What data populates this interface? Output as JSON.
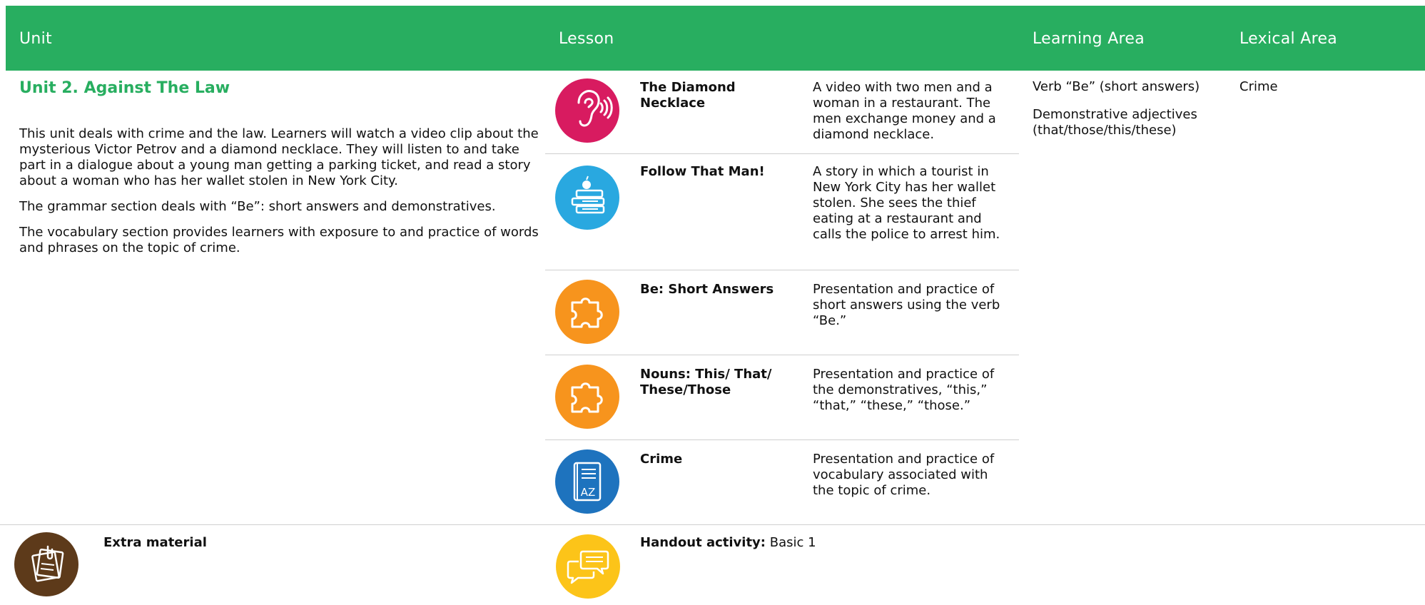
{
  "header": {
    "unit": "Unit",
    "lesson": "Lesson",
    "learning_area": "Learning Area",
    "lexical_area": "Lexical Area"
  },
  "unit": {
    "title": "Unit 2. Against The Law",
    "paragraphs": [
      "This unit deals with crime and the law. Learners will watch a video clip about the mysterious Victor Petrov and a diamond necklace. They will listen to and take part in a dialogue about a young man getting a parking ticket, and read a story about a woman who has her wallet stolen in New York City.",
      "The grammar section deals with “Be”: short answers and demonstratives.",
      "The vocabulary section provides learners with exposure to and practice of words and phrases on the topic of crime."
    ]
  },
  "lessons": [
    {
      "icon": "ear-icon",
      "color": "#d81b60",
      "title": "The Diamond Necklace",
      "description": "A video with two men and a woman in a restaurant. The men exchange money and a diamond necklace."
    },
    {
      "icon": "books-apple-icon",
      "color": "#29a8e0",
      "title": "Follow That Man!",
      "description": "A story in which a tourist in New York City has her wallet stolen. She sees the thief eating at a restaurant and calls the police to arrest him."
    },
    {
      "icon": "puzzle-icon",
      "color": "#f7941d",
      "title": "Be: Short Answers",
      "description": "Presentation and practice of short answers using the verb “Be.”"
    },
    {
      "icon": "puzzle-icon",
      "color": "#f7941d",
      "title": "Nouns: This/ That/ These/Those",
      "description": "Presentation and practice of the demonstratives, “this,” “that,” “these,” “those.”"
    },
    {
      "icon": "dictionary-icon",
      "color": "#1e73be",
      "title": "Crime",
      "description": "Presentation and practice of vocabulary associated with the topic of crime."
    }
  ],
  "learning_area": [
    "Verb “Be” (short answers)",
    "Demonstrative adjectives (that/those/this/these)"
  ],
  "lexical_area": "Crime",
  "extra": {
    "label": "Extra material",
    "icon": "notes-icon",
    "color": "#5d3a1a",
    "handout_label": "Handout activity:",
    "handout_value": "Basic 1",
    "handout_icon": "chat-bubbles-icon",
    "handout_color": "#fcc419"
  }
}
